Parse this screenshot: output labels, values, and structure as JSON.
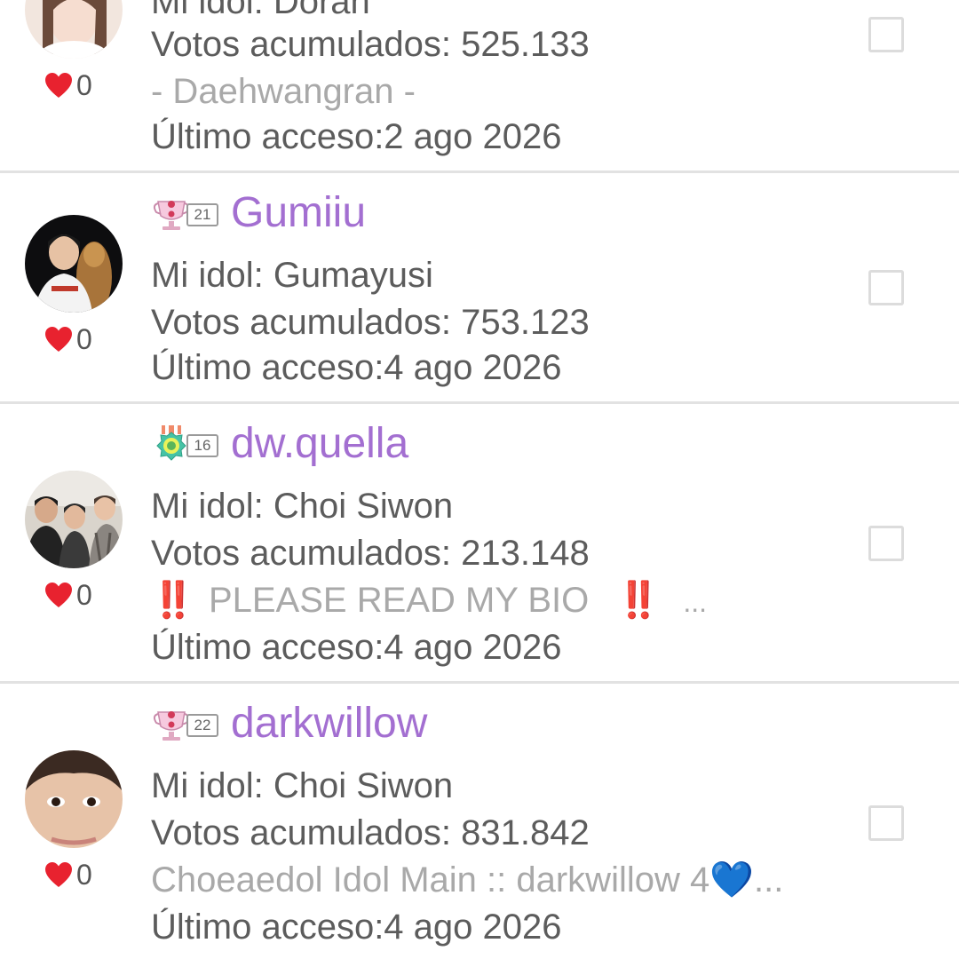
{
  "users": [
    {
      "username": "",
      "level": "",
      "idol_line": "Mi idol: Doran",
      "votes_line": "Votos acumulados: 525.133",
      "status": "- Daehwangran -",
      "last_access": "Último acceso:2 ago 2026",
      "likes": "0",
      "badge_icon": "badge-icon"
    },
    {
      "username": "Gumiiu",
      "level": "21",
      "idol_line": "Mi idol: Gumayusi",
      "votes_line": "Votos acumulados: 753.123",
      "status": "",
      "last_access": "Último acceso:4 ago 2026",
      "likes": "0",
      "badge_icon": "pink-trophy-icon"
    },
    {
      "username": "dw.quella",
      "level": "16",
      "idol_line": "Mi idol: Choi Siwon",
      "votes_line": "Votos acumulados: 213.148",
      "status": "PLEASE READ MY BIO",
      "status_emoji": "‼️",
      "status_ellipsis": "...",
      "last_access": "Último acceso:4 ago 2026",
      "likes": "0",
      "badge_icon": "teal-medal-icon"
    },
    {
      "username": "darkwillow",
      "level": "22",
      "idol_line": "Mi idol: Choi Siwon",
      "votes_line": "Votos acumulados: 831.842",
      "status": "Choeaedol Idol Main :: darkwillow 4💙...",
      "last_access": "Último acceso:4 ago 2026",
      "likes": "0",
      "badge_icon": "pink-trophy-icon"
    }
  ],
  "colors": {
    "username": "#a36fd1",
    "primary_text": "#5c5c5c",
    "secondary_text": "#a9a9a9",
    "heart": "#e8222f",
    "divider": "#e2e2e2",
    "checkbox_border": "#dcdcdc"
  },
  "icons": {
    "like": "heart-icon",
    "select": "checkbox"
  }
}
